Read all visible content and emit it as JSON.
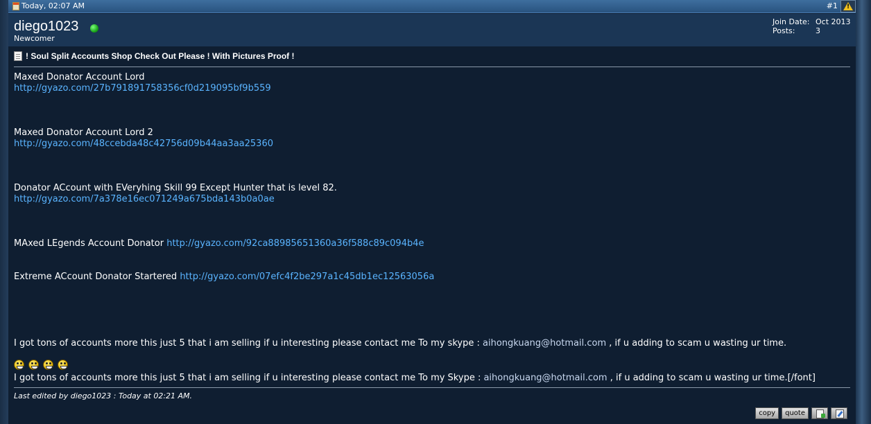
{
  "post_header": {
    "date": "Today, 02:07 AM",
    "post_number": "#1"
  },
  "user": {
    "name": "diego1023",
    "rank": "Newcomer",
    "join_date_label": "Join Date:",
    "join_date": "Oct 2013",
    "posts_label": "Posts:",
    "posts": "3",
    "online_color": "#22c022"
  },
  "post": {
    "title": "! Soul Split Accounts Shop Check Out Please ! With Pictures Proof !",
    "line1": "Maxed Donator Account Lord",
    "link1": "http://gyazo.com/27b791891758356cf0d219095bf9b559",
    "line2": "Maxed Donator Account Lord 2",
    "link2": "http://gyazo.com/48ccebda48c42756d09b44aa3aa25360",
    "line3": "Donator ACcount with EVeryhing Skill 99 Except Hunter that is level 82.",
    "link3": "http://gyazo.com/7a378e16ec071249a675bda143b0a0ae",
    "line4": "MAxed LEgends Account Donator",
    "link4": "http://gyazo.com/92ca88985651360a36f588c89c094b4e",
    "line5": "Extreme ACcount Donator Startered",
    "link5": "http://gyazo.com/07efc4f2be297a1c45db1ec12563056a",
    "contact1_prefix": "I got tons of accounts more this just 5 that i am selling if u interesting please contact me To my skype :",
    "contact1_email": "aihongkuang@hotmail.com",
    "contact1_suffix": ", if u adding to scam u wasting ur time.",
    "contact2_prefix": "I got tons of accounts more this just 5 that i am selling if u interesting please contact me To my Skype :",
    "contact2_email": "aihongkuang@hotmail.com",
    "contact2_suffix": ", if u adding to scam u wasting ur time.[/font]",
    "smilies": [
      "laughing-smiley-icon",
      "laughing-smiley-icon",
      "laughing-smiley-icon",
      "laughing-smiley-icon"
    ],
    "last_edited": "Last edited by diego1023 : Today at 02:21 AM."
  },
  "actions": {
    "copy_label": "copy",
    "quote_label": "quote"
  },
  "colors": {
    "link": "#5ab4ff",
    "background": "#0f1e31",
    "header": "#29537f"
  }
}
